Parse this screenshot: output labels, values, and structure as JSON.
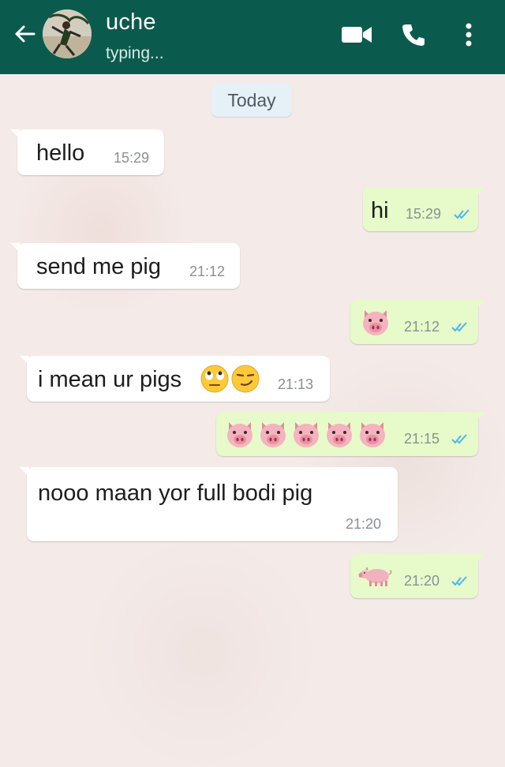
{
  "header": {
    "contact_name": "uche",
    "status": "typing...",
    "icons": [
      "back-arrow-icon",
      "video-call-icon",
      "phone-icon",
      "menu-dots-icon"
    ],
    "color": "#0b5a4e"
  },
  "chat": {
    "date_label": "Today",
    "messages": [
      {
        "direction": "incoming",
        "text": "hello",
        "time": "15:29"
      },
      {
        "direction": "outgoing",
        "text": "hi",
        "time": "15:29",
        "status": "read"
      },
      {
        "direction": "incoming",
        "text": "send me pig",
        "time": "21:12"
      },
      {
        "direction": "outgoing",
        "emoji": "pig-face",
        "count": 1,
        "time": "21:12",
        "status": "read"
      },
      {
        "direction": "incoming",
        "text": "i mean ur pigs",
        "emoji_after": [
          "face-with-rolling-eyes",
          "smirking-face"
        ],
        "time": "21:13"
      },
      {
        "direction": "outgoing",
        "emoji": "pig-face",
        "count": 5,
        "time": "21:15",
        "status": "read"
      },
      {
        "direction": "incoming",
        "text": "nooo maan yor full bodi pig",
        "time": "21:20"
      },
      {
        "direction": "outgoing",
        "emoji": "pig",
        "count": 1,
        "time": "21:20",
        "status": "read"
      }
    ]
  },
  "colors": {
    "incoming_bubble": "#ffffff",
    "outgoing_bubble": "#e6fbc9",
    "read_ticks": "#4fb6ec",
    "wallpaper": "#f4ebe8"
  }
}
